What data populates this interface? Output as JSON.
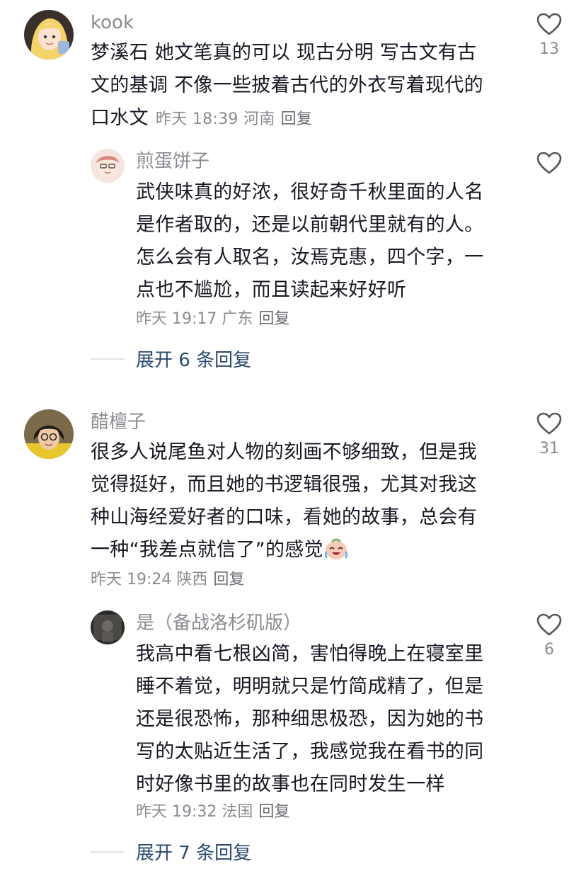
{
  "comments": [
    {
      "username": "kook",
      "lines": [
        "梦溪石 她文笔真的可以 现古分明 写古文有古",
        "文的基调 不像一些披着古代的外衣写着现代的",
        "口水文"
      ],
      "time": "昨天 18:39",
      "location": "河南",
      "reply_label": "回复",
      "likes": "13",
      "sub": {
        "username": "煎蛋饼子",
        "lines": [
          "武侠味真的好浓，很好奇千秋里面的人名",
          "是作者取的，还是以前朝代里就有的人。",
          "怎么会有人取名，汝焉克惠，四个字，一",
          "点也不尴尬，而且读起来好好听"
        ],
        "time": "昨天 19:17",
        "location": "广东",
        "reply_label": "回复"
      },
      "expand_label": "展开 6 条回复"
    },
    {
      "username": "醋檀子",
      "lines": [
        "很多人说尾鱼对人物的刻画不够细致，但是我",
        "觉得挺好，而且她的书逻辑很强，尤其对我这",
        "种山海经爱好者的口味，看她的故事，总会有",
        "一种“我差点就信了”的感觉"
      ],
      "time": "昨天 19:24",
      "location": "陕西",
      "reply_label": "回复",
      "likes": "31",
      "sub": {
        "username": "是（备战洛杉矶版）",
        "lines": [
          "我高中看七根凶简，害怕得晚上在寝室里",
          "睡不着觉，明明就只是竹简成精了，但是",
          "还是很恐怖，那种细思极恐，因为她的书",
          "写的太贴近生活了，我感觉我在看书的同",
          "时好像书里的故事也在同时发生一样"
        ],
        "time": "昨天 19:32",
        "location": "法国",
        "reply_label": "回复",
        "likes": "6"
      },
      "expand_label": "展开 7 条回复"
    }
  ],
  "icons": {
    "like": "heart-outline-icon",
    "emoji": "crying-laughing-emoji-icon"
  },
  "colors": {
    "text": "#161823",
    "muted": "#8a8b91",
    "link": "#2b4a6f"
  }
}
